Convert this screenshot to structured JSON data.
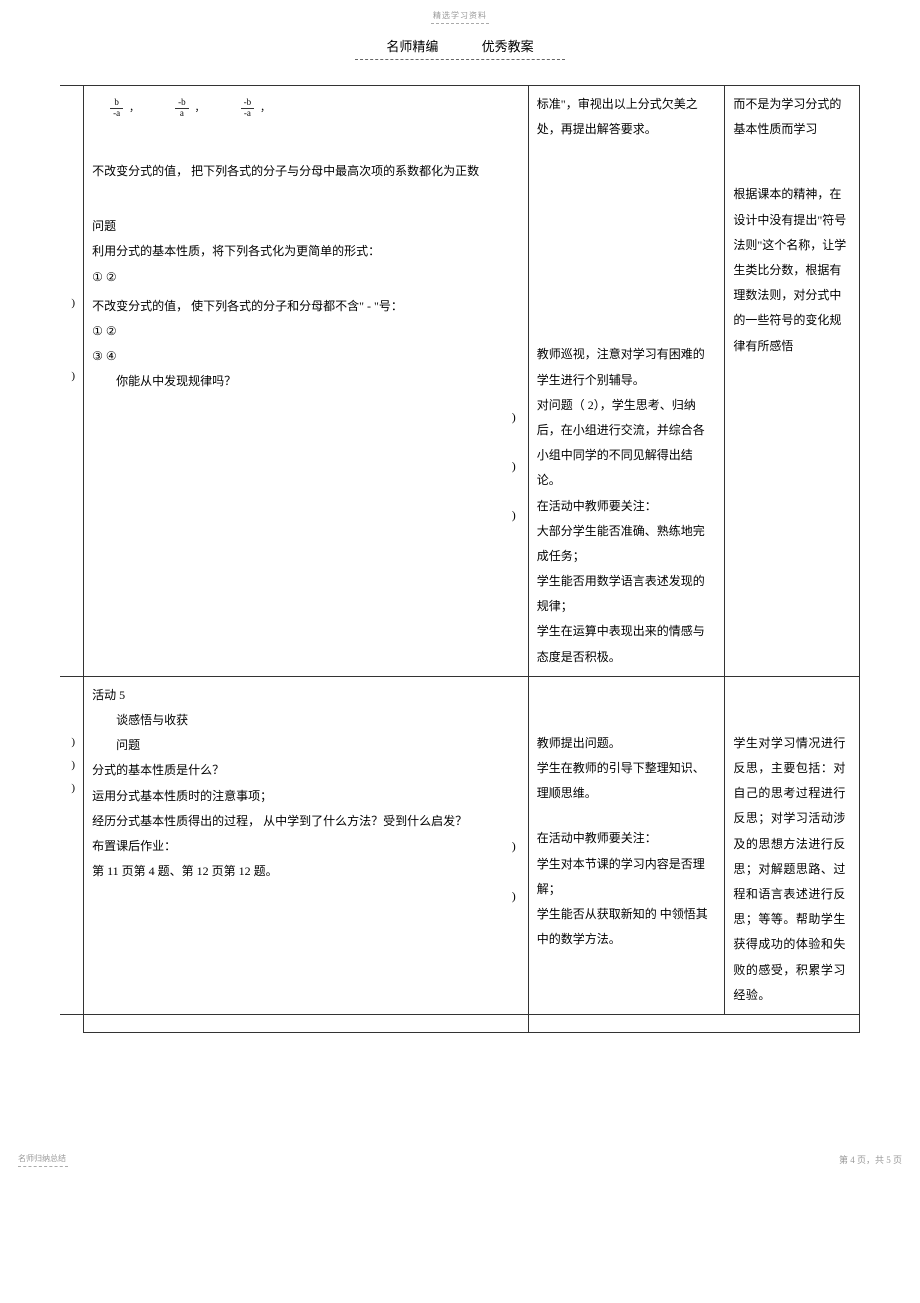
{
  "top_label": "精选学习资料",
  "header_left": "名师精编",
  "header_right": "优秀教案",
  "fractions": [
    {
      "num": "b",
      "den": "-a"
    },
    {
      "num": "-b",
      "den": "a"
    },
    {
      "num": "-b",
      "den": "-a"
    }
  ],
  "row1": {
    "col0_markers": [
      ")",
      ")"
    ],
    "col1_a": "不改变分式的值，    把下列各式的分子与分母中最高次项的系数都化为正数",
    "col1_q": "问题",
    "col1_b": "利用分式的基本性质，将下列各式化为更简单的形式：",
    "col1_c": "① ②",
    "col1_d": "不改变分式的值，   使下列各式的分子和分母都不含\"      - \"号：",
    "col1_e": "①        ②",
    "col1_f": "③        ④",
    "col1_g": "你能从中发现规律吗？",
    "col2_a": "标准\"，审视出以上分式欠美之处，再提出解答要求。",
    "col2_b": "教师巡视，注意对学习有困难的学生进行个别辅导。",
    "col2_c": "对问题（ 2），学生思考、归纳后，在小组进行交流，并综合各小组中同学的不同见解得出结论。",
    "col2_d": "在活动中教师要关注：",
    "col2_e": "大部分学生能否准确、熟练地完成任务；",
    "col2_f": "学生能否用数学语言表述发现的规律；",
    "col2_g": "学生在运算中表现出来的情感与态度是否积极。",
    "col3_a": "而不是为学习分式的基本性质而学习",
    "col3_b": "根据课本的精神，在设计中没有提出\"符号法则\"这个名称，让学生类比分数，根据有理数法则，对分式中的一些符号的变化规律有所感悟"
  },
  "row2": {
    "col0_markers": [
      ")",
      ")",
      ")"
    ],
    "act_title": "活动 5",
    "act_sub": "谈感悟与收获",
    "act_q": "问题",
    "q1": "分式的基本性质是什么？",
    "q2": "运用分式基本性质时的注意事项；",
    "q3": "经历分式基本性质得出的过程，    从中学到了什么方法？受到什么启发？",
    "hw1": "布置课后作业：",
    "hw2": "第 11 页第  4 题、第  12 页第 12 题。",
    "col2_a": "教师提出问题。",
    "col2_b": "学生在教师的引导下整理知识、理顺思维。",
    "col2_c": "在活动中教师要关注：",
    "col2_d": "学生对本节课的学习内容是否理解；",
    "col2_e": "学生能否从获取新知的      中领悟其中的数学方法。",
    "col3": "学生对学习情况进行反思，主要包括：对自己的思考过程进行反思；对学习活动涉及的思想方法进行反思；对解题思路、过程和语言表述进行反思；等等。帮助学生获得成功的体验和失败的感受，积累学习经验。"
  },
  "footer_left": "名师归纳总结",
  "footer_right": "第 4 页，共 5 页"
}
